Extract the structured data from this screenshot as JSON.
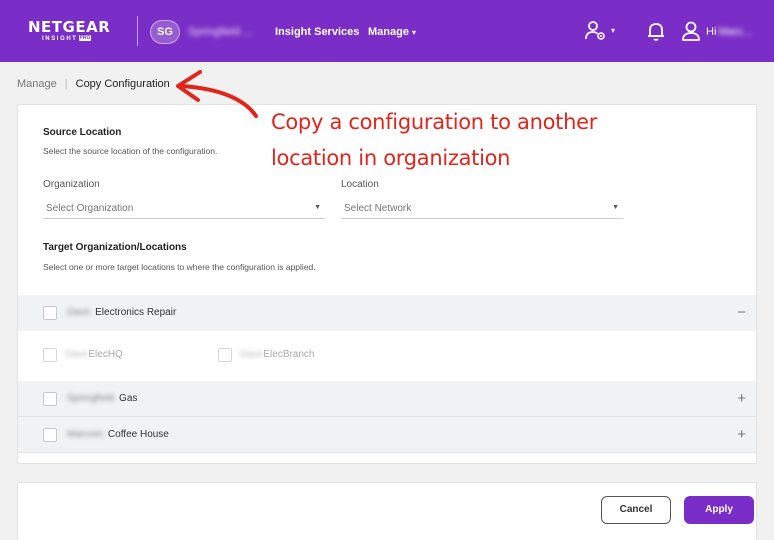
{
  "colors": {
    "brand": "#7a2ec7",
    "annotation": "#e0261b",
    "row_bg": "#f1f2f4"
  },
  "header": {
    "logo_main": "NETGEAR",
    "logo_sub": "INSIGHT",
    "logo_pro": "PRO",
    "org_initials": "SG",
    "org_name": "Springfield ...",
    "nav_insight": "Insight Services",
    "nav_manage": "Manage",
    "greeting": "Hi",
    "user_name": "Marc..."
  },
  "breadcrumb": {
    "parent": "Manage",
    "current": "Copy Configuration"
  },
  "annotation": {
    "line1": "Copy a configuration to another",
    "line2": "location in organization"
  },
  "source": {
    "title": "Source Location",
    "description": "Select the source location of the configuration.",
    "org_label": "Organization",
    "org_placeholder": "Select Organization",
    "loc_label": "Location",
    "loc_placeholder": "Select Network"
  },
  "target": {
    "title": "Target Organization/Locations",
    "description": "Select one or more target locations to where the configuration is applied.",
    "groups": [
      {
        "blurred": "Dave",
        "name": "Electronics Repair",
        "toggle": "−"
      },
      {
        "blurred": "Springfield",
        "name": "Gas",
        "toggle": "+"
      },
      {
        "blurred": "Marcom",
        "name": "Coffee House",
        "toggle": "+"
      }
    ],
    "sub_items": [
      {
        "blurred": "Dave",
        "name": "ElecHQ"
      },
      {
        "blurred": "Dave",
        "name": "ElecBranch"
      }
    ]
  },
  "footer": {
    "cancel": "Cancel",
    "apply": "Apply"
  }
}
